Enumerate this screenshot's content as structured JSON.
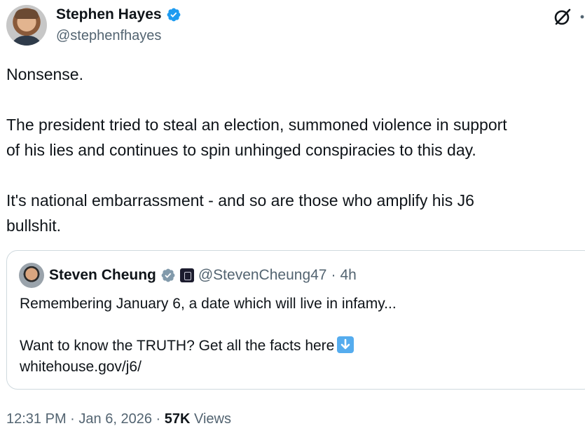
{
  "author": {
    "name": "Stephen Hayes",
    "handle": "@stephenfhayes"
  },
  "post": {
    "text": "Nonsense.\n\nThe president tried to steal an election, summoned violence in support\nof his lies and continues to spin unhinged conspiracies to this day.\n\nIt's national embarrassment - and so are those who amplify his J6\nbullshit."
  },
  "quote": {
    "name": "Steven Cheung",
    "handle": "@StevenCheung47",
    "separator": "·",
    "time": "4h",
    "line1": "Remembering January 6, a date which will live in infamy...",
    "line2": "Want to know the TRUTH? Get all the facts here",
    "link": "whitehouse.gov/j6/"
  },
  "meta": {
    "time": "12:31 PM",
    "separator": "·",
    "date": "Jan 6, 2026",
    "views_count": "57K",
    "views_label": "Views"
  },
  "colors": {
    "verified_blue": "#1d9bf0",
    "verified_gray": "#829aab",
    "secondary_text": "#536471",
    "border": "#cfd9de"
  },
  "icons": {
    "verified": "verified-badge-icon",
    "grok": "grok-icon",
    "more": "more-icon",
    "down_arrow": "down-arrow-emoji-icon"
  }
}
